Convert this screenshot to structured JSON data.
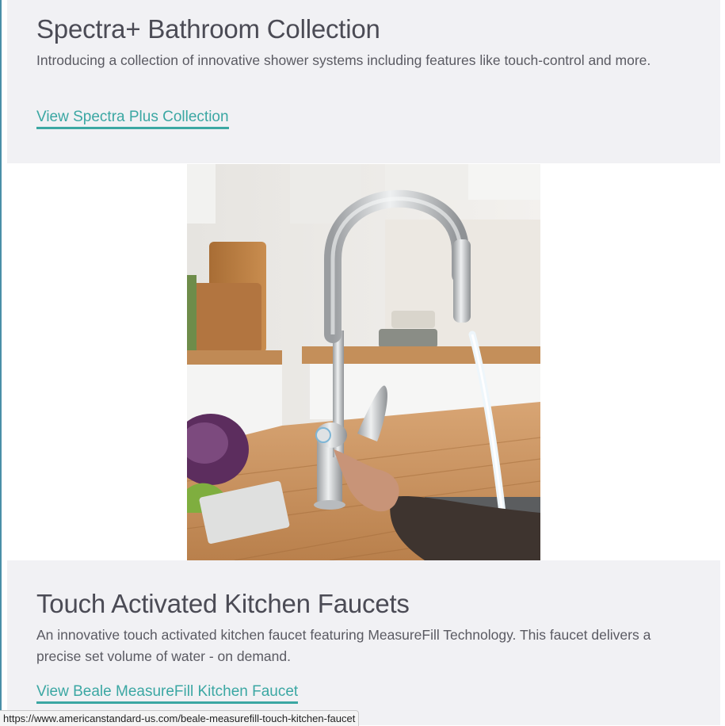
{
  "sections": [
    {
      "title": "Spectra+ Bathroom Collection",
      "description": "Introducing a collection of innovative shower systems including features like touch-control and more.",
      "link_label": "View Spectra Plus Collection"
    },
    {
      "title": "Touch Activated Kitchen Faucets",
      "description": "An innovative touch activated kitchen faucet featuring MeasureFill Technology. This faucet delivers a precise set volume of water - on demand.",
      "link_label": "View Beale MeasureFill Kitchen Faucet"
    }
  ],
  "hero_image": {
    "icon": "kitchen-faucet-photo"
  },
  "status_bar": {
    "url": "https://www.americanstandard-us.com/beale-measurefill-touch-kitchen-faucet"
  },
  "colors": {
    "panel_bg": "#f1f1f4",
    "link": "#3ba7a3",
    "heading": "#4b4b55",
    "body_text": "#5a5a62"
  }
}
